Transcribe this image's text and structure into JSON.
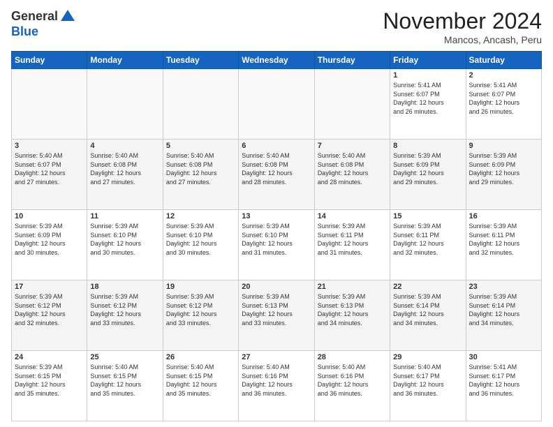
{
  "logo": {
    "general": "General",
    "blue": "Blue"
  },
  "header": {
    "month": "November 2024",
    "location": "Mancos, Ancash, Peru"
  },
  "weekdays": [
    "Sunday",
    "Monday",
    "Tuesday",
    "Wednesday",
    "Thursday",
    "Friday",
    "Saturday"
  ],
  "weeks": [
    [
      {
        "day": "",
        "info": ""
      },
      {
        "day": "",
        "info": ""
      },
      {
        "day": "",
        "info": ""
      },
      {
        "day": "",
        "info": ""
      },
      {
        "day": "",
        "info": ""
      },
      {
        "day": "1",
        "info": "Sunrise: 5:41 AM\nSunset: 6:07 PM\nDaylight: 12 hours\nand 26 minutes."
      },
      {
        "day": "2",
        "info": "Sunrise: 5:41 AM\nSunset: 6:07 PM\nDaylight: 12 hours\nand 26 minutes."
      }
    ],
    [
      {
        "day": "3",
        "info": "Sunrise: 5:40 AM\nSunset: 6:07 PM\nDaylight: 12 hours\nand 27 minutes."
      },
      {
        "day": "4",
        "info": "Sunrise: 5:40 AM\nSunset: 6:08 PM\nDaylight: 12 hours\nand 27 minutes."
      },
      {
        "day": "5",
        "info": "Sunrise: 5:40 AM\nSunset: 6:08 PM\nDaylight: 12 hours\nand 27 minutes."
      },
      {
        "day": "6",
        "info": "Sunrise: 5:40 AM\nSunset: 6:08 PM\nDaylight: 12 hours\nand 28 minutes."
      },
      {
        "day": "7",
        "info": "Sunrise: 5:40 AM\nSunset: 6:08 PM\nDaylight: 12 hours\nand 28 minutes."
      },
      {
        "day": "8",
        "info": "Sunrise: 5:39 AM\nSunset: 6:09 PM\nDaylight: 12 hours\nand 29 minutes."
      },
      {
        "day": "9",
        "info": "Sunrise: 5:39 AM\nSunset: 6:09 PM\nDaylight: 12 hours\nand 29 minutes."
      }
    ],
    [
      {
        "day": "10",
        "info": "Sunrise: 5:39 AM\nSunset: 6:09 PM\nDaylight: 12 hours\nand 30 minutes."
      },
      {
        "day": "11",
        "info": "Sunrise: 5:39 AM\nSunset: 6:10 PM\nDaylight: 12 hours\nand 30 minutes."
      },
      {
        "day": "12",
        "info": "Sunrise: 5:39 AM\nSunset: 6:10 PM\nDaylight: 12 hours\nand 30 minutes."
      },
      {
        "day": "13",
        "info": "Sunrise: 5:39 AM\nSunset: 6:10 PM\nDaylight: 12 hours\nand 31 minutes."
      },
      {
        "day": "14",
        "info": "Sunrise: 5:39 AM\nSunset: 6:11 PM\nDaylight: 12 hours\nand 31 minutes."
      },
      {
        "day": "15",
        "info": "Sunrise: 5:39 AM\nSunset: 6:11 PM\nDaylight: 12 hours\nand 32 minutes."
      },
      {
        "day": "16",
        "info": "Sunrise: 5:39 AM\nSunset: 6:11 PM\nDaylight: 12 hours\nand 32 minutes."
      }
    ],
    [
      {
        "day": "17",
        "info": "Sunrise: 5:39 AM\nSunset: 6:12 PM\nDaylight: 12 hours\nand 32 minutes."
      },
      {
        "day": "18",
        "info": "Sunrise: 5:39 AM\nSunset: 6:12 PM\nDaylight: 12 hours\nand 33 minutes."
      },
      {
        "day": "19",
        "info": "Sunrise: 5:39 AM\nSunset: 6:12 PM\nDaylight: 12 hours\nand 33 minutes."
      },
      {
        "day": "20",
        "info": "Sunrise: 5:39 AM\nSunset: 6:13 PM\nDaylight: 12 hours\nand 33 minutes."
      },
      {
        "day": "21",
        "info": "Sunrise: 5:39 AM\nSunset: 6:13 PM\nDaylight: 12 hours\nand 34 minutes."
      },
      {
        "day": "22",
        "info": "Sunrise: 5:39 AM\nSunset: 6:14 PM\nDaylight: 12 hours\nand 34 minutes."
      },
      {
        "day": "23",
        "info": "Sunrise: 5:39 AM\nSunset: 6:14 PM\nDaylight: 12 hours\nand 34 minutes."
      }
    ],
    [
      {
        "day": "24",
        "info": "Sunrise: 5:39 AM\nSunset: 6:15 PM\nDaylight: 12 hours\nand 35 minutes."
      },
      {
        "day": "25",
        "info": "Sunrise: 5:40 AM\nSunset: 6:15 PM\nDaylight: 12 hours\nand 35 minutes."
      },
      {
        "day": "26",
        "info": "Sunrise: 5:40 AM\nSunset: 6:15 PM\nDaylight: 12 hours\nand 35 minutes."
      },
      {
        "day": "27",
        "info": "Sunrise: 5:40 AM\nSunset: 6:16 PM\nDaylight: 12 hours\nand 36 minutes."
      },
      {
        "day": "28",
        "info": "Sunrise: 5:40 AM\nSunset: 6:16 PM\nDaylight: 12 hours\nand 36 minutes."
      },
      {
        "day": "29",
        "info": "Sunrise: 5:40 AM\nSunset: 6:17 PM\nDaylight: 12 hours\nand 36 minutes."
      },
      {
        "day": "30",
        "info": "Sunrise: 5:41 AM\nSunset: 6:17 PM\nDaylight: 12 hours\nand 36 minutes."
      }
    ]
  ]
}
